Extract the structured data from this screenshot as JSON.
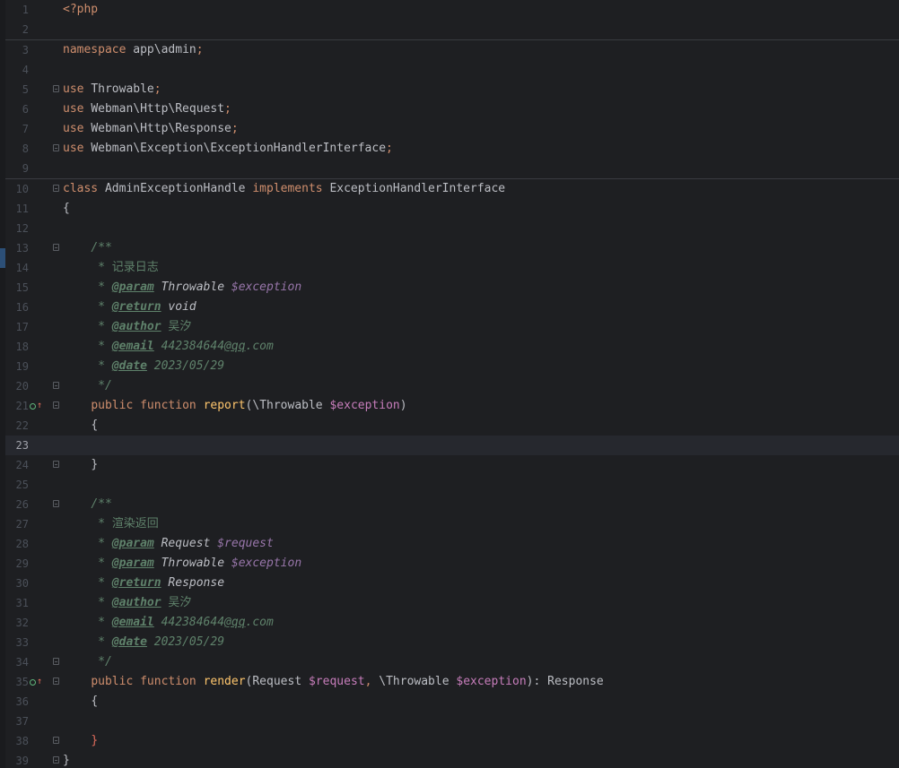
{
  "editor": {
    "current_line": 23,
    "line_numbers": [
      "1",
      "2",
      "3",
      "4",
      "5",
      "6",
      "7",
      "8",
      "9",
      "10",
      "11",
      "12",
      "13",
      "14",
      "15",
      "16",
      "17",
      "18",
      "19",
      "20",
      "21",
      "22",
      "23",
      "24",
      "25",
      "26",
      "27",
      "28",
      "29",
      "30",
      "31",
      "32",
      "33",
      "34",
      "35",
      "36",
      "37",
      "38",
      "39"
    ],
    "code": {
      "l1": "<?php",
      "l3": {
        "kw": "namespace",
        "name": "app\\admin",
        "semi": ";"
      },
      "l5": {
        "kw": "use",
        "name": "Throwable",
        "semi": ";"
      },
      "l6": {
        "kw": "use",
        "name": "Webman\\Http\\Request",
        "semi": ";"
      },
      "l7": {
        "kw": "use",
        "name": "Webman\\Http\\Response",
        "semi": ";"
      },
      "l8": {
        "kw": "use",
        "name": "Webman\\Exception\\ExceptionHandlerInterface",
        "semi": ";"
      },
      "l10": {
        "kw1": "class",
        "name": "AdminExceptionHandle",
        "kw2": "implements",
        "iface": "ExceptionHandlerInterface"
      },
      "l11": "{",
      "l13": "/**",
      "l14": {
        "star": "*",
        "text": "记录日志"
      },
      "l15": {
        "star": "*",
        "tag": "@param",
        "type": "Throwable",
        "var": "$exception"
      },
      "l16": {
        "star": "*",
        "tag": "@return",
        "type": "void"
      },
      "l17": {
        "star": "*",
        "tag": "@author",
        "text": "吴汐"
      },
      "l18": {
        "star": "*",
        "tag": "@email",
        "pre": "442384644",
        "link": "@qq",
        "post": ".com"
      },
      "l19": {
        "star": "*",
        "tag": "@date",
        "text": "2023/05/29"
      },
      "l20": "*/",
      "l21": {
        "mod": "public",
        "fn": "function",
        "name": "report",
        "open": "(",
        "ns": "\\",
        "type": "Throwable",
        "var": "$exception",
        "close": ")"
      },
      "l22": "{",
      "l24": "}",
      "l26": "/**",
      "l27": {
        "star": "*",
        "text": "渲染返回"
      },
      "l28": {
        "star": "*",
        "tag": "@param",
        "type": "Request",
        "var": "$request"
      },
      "l29": {
        "star": "*",
        "tag": "@param",
        "type": "Throwable",
        "var": "$exception"
      },
      "l30": {
        "star": "*",
        "tag": "@return",
        "type": "Response"
      },
      "l31": {
        "star": "*",
        "tag": "@author",
        "text": "吴汐"
      },
      "l32": {
        "star": "*",
        "tag": "@email",
        "pre": "442384644",
        "link": "@qq",
        "post": ".com"
      },
      "l33": {
        "star": "*",
        "tag": "@date",
        "text": "2023/05/29"
      },
      "l34": "*/",
      "l35": {
        "mod": "public",
        "fn": "function",
        "name": "render",
        "open": "(",
        "type1": "Request",
        "var1": "$request",
        "comma": ", ",
        "ns": "\\",
        "type2": "Throwable",
        "var2": "$exception",
        "close": "): ",
        "ret": "Response"
      },
      "l36": "{",
      "l38": "}",
      "l39": "}"
    }
  },
  "colors": {
    "background": "#1e1f22",
    "keyword": "#cf8e6d",
    "identifier": "#bcbec4",
    "function_name": "#56a8f5",
    "variable": "#c77dbb",
    "doc_comment": "#5f826b",
    "current_line": "#26282e"
  },
  "icons": {
    "fold": "fold-marker-icon",
    "implements": "implementing-method-icon"
  }
}
